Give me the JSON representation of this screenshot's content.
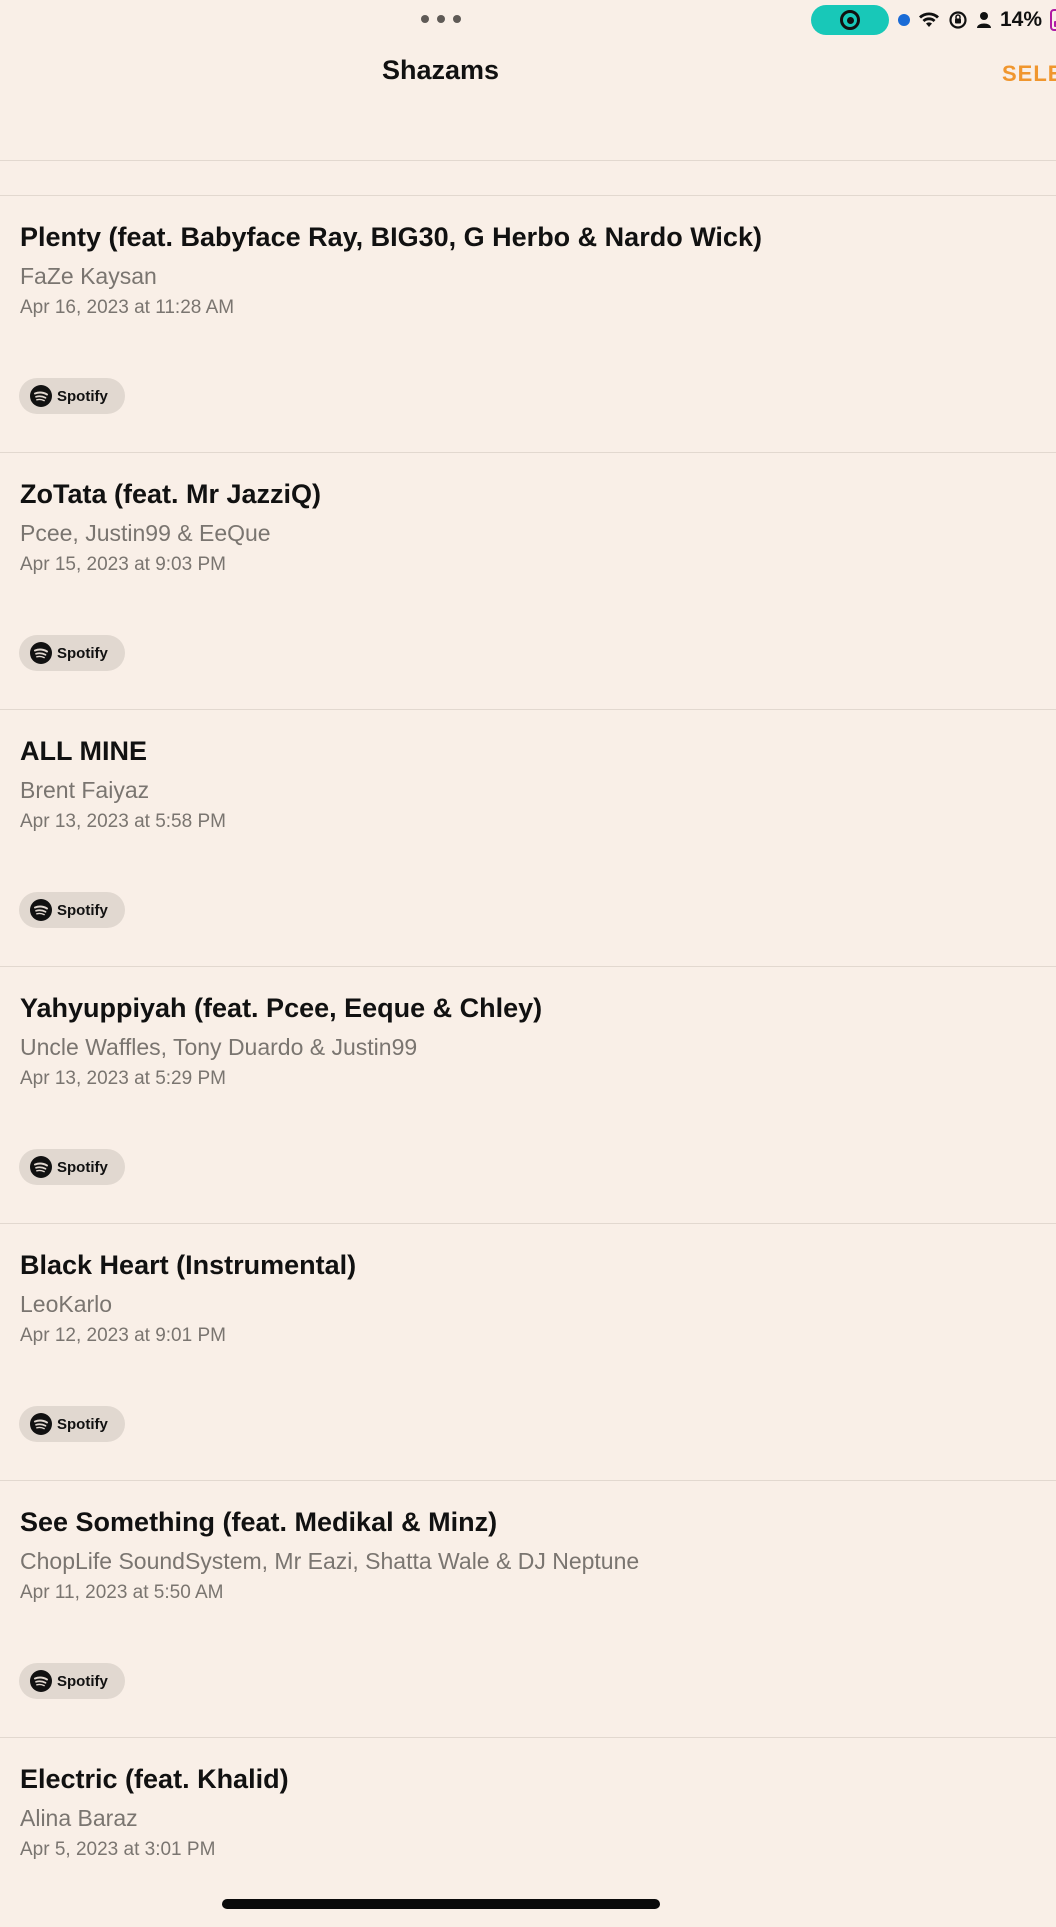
{
  "status_bar": {
    "battery_percent": "14%",
    "battery_color": "#b01aa4",
    "record_pill_color": "#18c8b8",
    "icons": [
      "more-dots-icon",
      "screen-record-icon",
      "location-dot-icon",
      "wifi-icon",
      "rotation-lock-icon",
      "person-icon",
      "battery-icon"
    ]
  },
  "header": {
    "title": "Shazams",
    "select_label": "SELE",
    "accent_color": "#f0962e"
  },
  "items": [
    {
      "title": "Plenty (feat. Babyface Ray, BIG30, G Herbo & Nardo Wick)",
      "artist": "FaZe Kaysan",
      "date": "Apr 16, 2023 at 11:28 AM",
      "service": "Spotify"
    },
    {
      "title": "ZoTata (feat. Mr JazziQ)",
      "artist": "Pcee, Justin99 & EeQue",
      "date": "Apr 15, 2023 at 9:03 PM",
      "service": "Spotify"
    },
    {
      "title": "ALL MINE",
      "artist": "Brent Faiyaz",
      "date": "Apr 13, 2023 at 5:58 PM",
      "service": "Spotify"
    },
    {
      "title": "Yahyuppiyah (feat. Pcee, Eeque & Chley)",
      "artist": "Uncle Waffles, Tony Duardo & Justin99",
      "date": "Apr 13, 2023 at 5:29 PM",
      "service": "Spotify"
    },
    {
      "title": "Black Heart (Instrumental)",
      "artist": "LeoKarlo",
      "date": "Apr 12, 2023 at 9:01 PM",
      "service": "Spotify"
    },
    {
      "title": "See Something (feat. Medikal & Minz)",
      "artist": "ChopLife SoundSystem, Mr Eazi, Shatta Wale & DJ Neptune",
      "date": "Apr 11, 2023 at 5:50 AM",
      "service": "Spotify"
    },
    {
      "title": "Electric (feat. Khalid)",
      "artist": "Alina Baraz",
      "date": "Apr 5, 2023 at 3:01 PM",
      "service": ""
    }
  ]
}
